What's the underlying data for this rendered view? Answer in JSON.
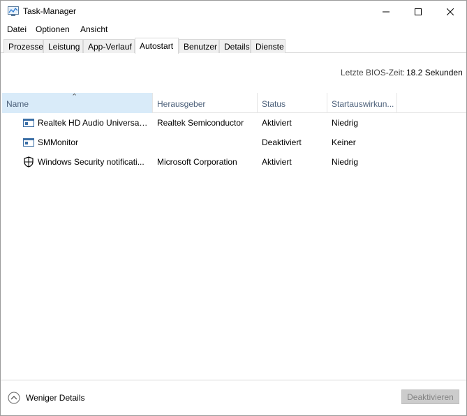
{
  "window": {
    "title": "Task-Manager",
    "icon": "task-manager-icon"
  },
  "menu": {
    "items": [
      "Datei",
      "Optionen",
      "Ansicht"
    ]
  },
  "tabs": [
    {
      "label": "Prozesse"
    },
    {
      "label": "Leistung"
    },
    {
      "label": "App-Verlauf"
    },
    {
      "label": "Autostart",
      "active": true
    },
    {
      "label": "Benutzer"
    },
    {
      "label": "Details"
    },
    {
      "label": "Dienste"
    }
  ],
  "bios": {
    "label": "Letzte BIOS-Zeit:",
    "value": "18.2 Sekunden"
  },
  "table": {
    "columns": [
      "Name",
      "Herausgeber",
      "Status",
      "Startauswirkun..."
    ],
    "sorted_column": "Name",
    "rows": [
      {
        "icon": "app-window-icon",
        "name": "Realtek HD Audio Universal ...",
        "publisher": "Realtek Semiconductor",
        "status": "Aktiviert",
        "impact": "Niedrig"
      },
      {
        "icon": "app-window-icon",
        "name": "SMMonitor",
        "publisher": "",
        "status": "Deaktiviert",
        "impact": "Keiner"
      },
      {
        "icon": "shield-icon",
        "name": "Windows Security notificati...",
        "publisher": "Microsoft Corporation",
        "status": "Aktiviert",
        "impact": "Niedrig"
      }
    ]
  },
  "footer": {
    "less_details": "Weniger Details",
    "deactivate": "Deaktivieren"
  },
  "colors": {
    "header_text": "#4c607a",
    "sorted_header_bg": "#d9ebf9",
    "disabled_button_bg": "#cccccc"
  }
}
